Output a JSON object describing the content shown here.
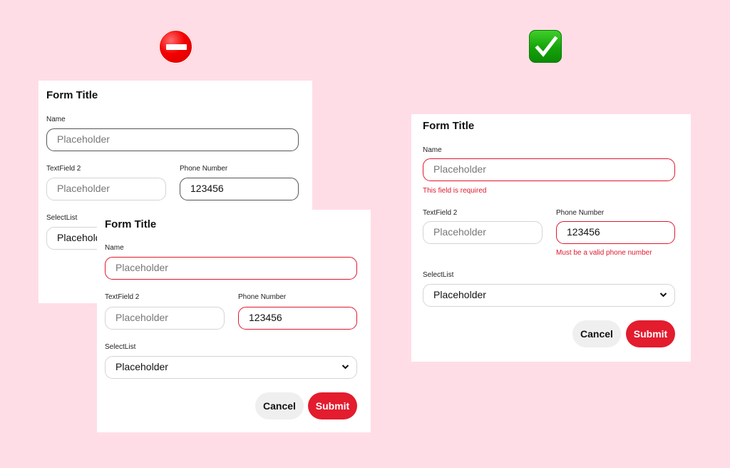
{
  "icons": {
    "bad_example": "no-entry-icon",
    "good_example": "check-mark-button-icon"
  },
  "colors": {
    "background": "#ffdde6",
    "error": "#e0182d",
    "submit": "#e31c2e",
    "cancel": "#efefef"
  },
  "forms": {
    "bad_back": {
      "title": "Form Title",
      "name_label": "Name",
      "name_placeholder": "Placeholder",
      "textfield2_label": "TextField 2",
      "textfield2_placeholder": "Placeholder",
      "phone_label": "Phone Number",
      "phone_value": "123456",
      "select_label": "SelectList",
      "select_value": "Placeholder"
    },
    "bad_front": {
      "title": "Form Title",
      "name_label": "Name",
      "name_placeholder": "Placeholder",
      "textfield2_label": "TextField 2",
      "textfield2_placeholder": "Placeholder",
      "phone_label": "Phone Number",
      "phone_value": "123456",
      "select_label": "SelectList",
      "select_value": "Placeholder",
      "cancel_label": "Cancel",
      "submit_label": "Submit"
    },
    "good": {
      "title": "Form Title",
      "name_label": "Name",
      "name_placeholder": "Placeholder",
      "name_error": "This field is required",
      "textfield2_label": "TextField 2",
      "textfield2_placeholder": "Placeholder",
      "phone_label": "Phone Number",
      "phone_value": "123456",
      "phone_error": "Must be a valid phone number",
      "select_label": "SelectList",
      "select_value": "Placeholder",
      "cancel_label": "Cancel",
      "submit_label": "Submit"
    }
  }
}
